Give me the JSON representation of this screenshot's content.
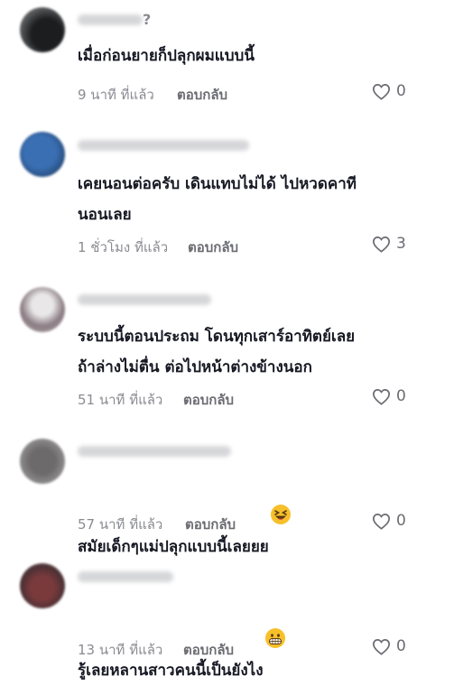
{
  "comments": [
    {
      "username_suffix": "?",
      "text": "เมื่อก่อนยายก็ปลุกผมแบบนี้",
      "time": "9 นาที ที่แล้ว",
      "reply_label": "ตอบกลับ",
      "likes": "0"
    },
    {
      "text": "เคยนอนต่อครับ เดินแทบไม่ได้ ไปหวดคาที\nนอนเลย",
      "time": "1 ชั่วโมง ที่แล้ว",
      "reply_label": "ตอบกลับ",
      "likes": "3"
    },
    {
      "text": "ระบบนี้ตอนประถม โดนทุกเสาร์อาทิตย์เลย\nถ้าล่างไม่ตื่น ต่อไปหน้าต่างข้างนอก",
      "time": "51 นาที ที่แล้ว",
      "reply_label": "ตอบกลับ",
      "likes": "0"
    },
    {
      "text": "สมัยเด็กๆแม่ปลุกแบบนี้เลยยย",
      "emoji": "laughing-squint-emoji",
      "time": "57 นาที ที่แล้ว",
      "reply_label": "ตอบกลับ",
      "likes": "0"
    },
    {
      "text": "รู้เลยหลานสาวคนนี้เป็นยังไง",
      "emoji": "grimacing-emoji",
      "time": "13 นาที ที่แล้ว",
      "reply_label": "ตอบกลับ",
      "likes": "0"
    }
  ],
  "colors": {
    "text": "#161823",
    "meta": "#8a8b91",
    "reply": "#6b6c72",
    "emoji_face": "#f7c02b",
    "emoji_tongue": "#e2465a"
  },
  "icons": {
    "like": "heart-outline-icon"
  }
}
